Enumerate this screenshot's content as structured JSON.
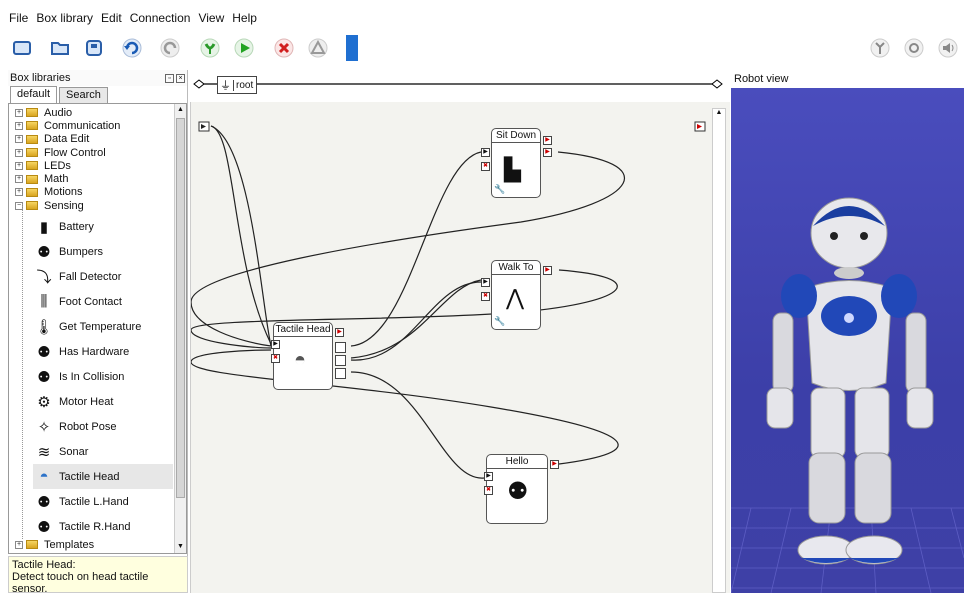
{
  "menu": [
    "File",
    "Box library",
    "Edit",
    "Connection",
    "View",
    "Help"
  ],
  "toolbar": {
    "buttons": [
      "new-icon",
      "open-icon",
      "save-icon",
      "undo-icon",
      "redo-icon",
      "connect-icon",
      "play-icon",
      "stop-icon",
      "debug-icon",
      "bar-icon"
    ],
    "right_buttons": [
      "robot-stiffness-icon",
      "robot-settings-icon",
      "volume-icon"
    ]
  },
  "left": {
    "title": "Box libraries",
    "tabs": [
      "default",
      "Search"
    ],
    "categories": [
      "Audio",
      "Communication",
      "Data Edit",
      "Flow Control",
      "LEDs",
      "Math",
      "Motions",
      "Sensing"
    ],
    "boxes": [
      "Battery",
      "Bumpers",
      "Fall Detector",
      "Foot Contact",
      "Get Temperature",
      "Has Hardware",
      "Is In Collision",
      "Motor Heat",
      "Robot Pose",
      "Sonar",
      "Tactile Head",
      "Tactile L.Hand",
      "Tactile R.Hand"
    ],
    "templates": "Templates",
    "description": {
      "title": "Tactile Head:",
      "text": "Detect touch on head tactile sensor."
    }
  },
  "diagram": {
    "root": "root",
    "boxes": {
      "sit_down": "Sit Down",
      "walk_to": "Walk To",
      "tactile_head": "Tactile Head",
      "hello": "Hello"
    }
  },
  "robot": {
    "title": "Robot view"
  },
  "colors": {
    "accent": "#1f6fd1",
    "robot_bg": "#4546b3",
    "folder": "#e8b930"
  }
}
